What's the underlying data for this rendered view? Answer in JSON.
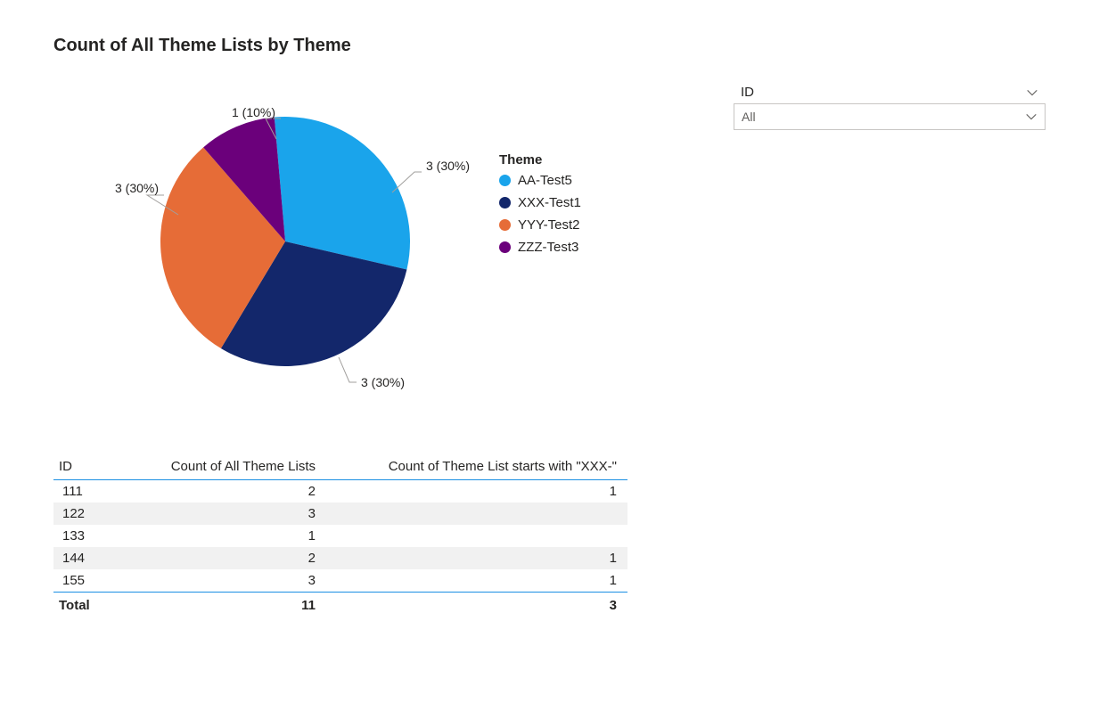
{
  "title": "Count of All Theme Lists by Theme",
  "chart_data": {
    "type": "pie",
    "title": "Count of All Theme Lists by Theme",
    "legend_title": "Theme",
    "total": 10,
    "series": [
      {
        "name": "AA-Test5",
        "value": 3,
        "pct": 30,
        "label": "3 (30%)",
        "color": "#1AA4EB"
      },
      {
        "name": "XXX-Test1",
        "value": 3,
        "pct": 30,
        "label": "3 (30%)",
        "color": "#13276B"
      },
      {
        "name": "YYY-Test2",
        "value": 3,
        "pct": 30,
        "label": "3 (30%)",
        "color": "#E66C37"
      },
      {
        "name": "ZZZ-Test3",
        "value": 1,
        "pct": 10,
        "label": "1 (10%)",
        "color": "#6B007B"
      }
    ]
  },
  "slicer": {
    "field": "ID",
    "selected": "All"
  },
  "table": {
    "columns": [
      "ID",
      "Count of All Theme Lists",
      "Count of Theme List starts with \"XXX-\""
    ],
    "rows": [
      {
        "id": "111",
        "count_all": "2",
        "count_xxx": "1"
      },
      {
        "id": "122",
        "count_all": "3",
        "count_xxx": ""
      },
      {
        "id": "133",
        "count_all": "1",
        "count_xxx": ""
      },
      {
        "id": "144",
        "count_all": "2",
        "count_xxx": "1"
      },
      {
        "id": "155",
        "count_all": "3",
        "count_xxx": "1"
      }
    ],
    "total_label": "Total",
    "total_all": "11",
    "total_xxx": "3"
  }
}
